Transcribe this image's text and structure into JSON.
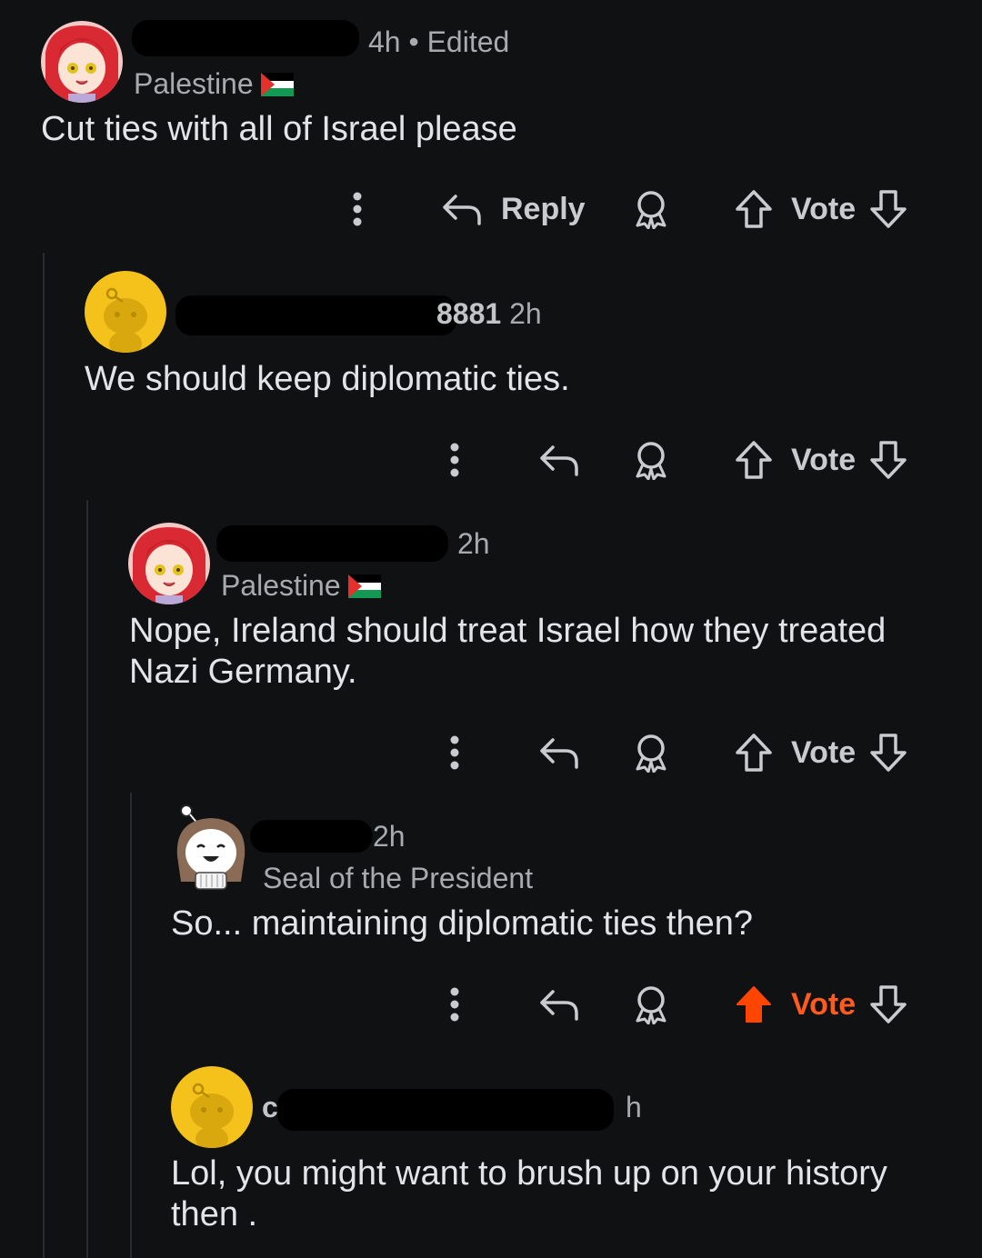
{
  "actions": {
    "reply_label": "Reply",
    "vote_label": "Vote"
  },
  "comments": [
    {
      "time": "4h",
      "edited": "Edited",
      "flair": "Palestine",
      "text": "Cut ties with all of Israel please"
    },
    {
      "name_fragment": "8881",
      "time": "2h",
      "text": "We should keep diplomatic ties."
    },
    {
      "time": "2h",
      "flair": "Palestine",
      "text_line1": "Nope, Ireland should treat Israel how they treated",
      "text_line2": "Nazi Germany."
    },
    {
      "time": "2h",
      "flair": "Seal of the President",
      "text": "So... maintaining diplomatic ties then?",
      "upvoted": true
    },
    {
      "name_fragment": "c",
      "time": "h",
      "text_line1": "Lol, you might want to brush up on your history",
      "text_line2": "then ."
    }
  ],
  "colors": {
    "upvote_active": "#ff4500",
    "background": "#0f1113"
  }
}
